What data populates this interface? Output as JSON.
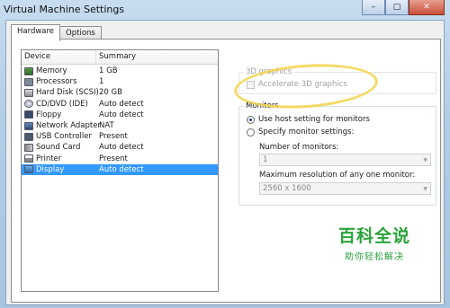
{
  "window": {
    "title": "Virtual Machine Settings"
  },
  "tabs": [
    {
      "label": "Hardware",
      "active": true
    },
    {
      "label": "Options",
      "active": false
    }
  ],
  "device_list": {
    "columns": {
      "device": "Device",
      "summary": "Summary"
    },
    "rows": [
      {
        "icon": "memory-icon",
        "device": "Memory",
        "summary": "1 GB"
      },
      {
        "icon": "processor-icon",
        "device": "Processors",
        "summary": "1"
      },
      {
        "icon": "hard-disk-icon",
        "device": "Hard Disk (SCSI)",
        "summary": "20 GB"
      },
      {
        "icon": "cd-dvd-icon",
        "device": "CD/DVD (IDE)",
        "summary": "Auto detect"
      },
      {
        "icon": "floppy-icon",
        "device": "Floppy",
        "summary": "Auto detect"
      },
      {
        "icon": "network-adapter-icon",
        "device": "Network Adapter",
        "summary": "NAT"
      },
      {
        "icon": "usb-icon",
        "device": "USB Controller",
        "summary": "Present"
      },
      {
        "icon": "sound-card-icon",
        "device": "Sound Card",
        "summary": "Auto detect"
      },
      {
        "icon": "printer-icon",
        "device": "Printer",
        "summary": "Present"
      },
      {
        "icon": "display-icon",
        "device": "Display",
        "summary": "Auto detect",
        "selected": true
      }
    ]
  },
  "graphics_3d": {
    "group_title": "3D graphics",
    "accelerate_label": "Accelerate 3D graphics",
    "accelerate_checked": false
  },
  "monitors": {
    "group_title": "Monitors",
    "use_host_label": "Use host setting for monitors",
    "specify_label": "Specify monitor settings:",
    "selected_option": "use_host",
    "num_monitors_label": "Number of monitors:",
    "num_monitors_value": "1",
    "max_res_label": "Maximum resolution of any one monitor:",
    "max_res_value": "2560 x 1600"
  },
  "watermark": {
    "main": "百科全说",
    "sub": "助你轻松解决"
  },
  "colors": {
    "selection": "#3399ff",
    "highlight": "#f2d44a",
    "watermark": "#2aa33a"
  }
}
